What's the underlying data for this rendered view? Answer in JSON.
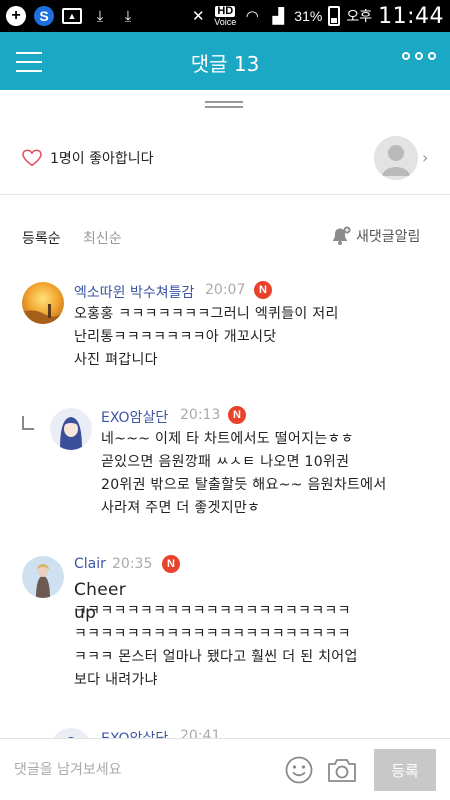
{
  "status_bar": {
    "battery_percent": "31%",
    "ampm": "오후",
    "time": "11:44",
    "hd_label": "HD",
    "voice_label": "Voice"
  },
  "header": {
    "title": "댓글 13"
  },
  "likes": {
    "text": "1명이 좋아합니다"
  },
  "sort": {
    "tabs": [
      "등록순",
      "최신순"
    ],
    "active": "등록순",
    "notify_label": "새댓글알림"
  },
  "comments": [
    {
      "name": "엑소따윈 박수쳐틀감",
      "time": "20:07",
      "badge": "N",
      "text": "오홍홍 ㅋㅋㅋㅋㅋㅋㅋ그러니 엑퀴들이 저리\n난리통ㅋㅋㅋㅋㅋㅋㅋ아 개꼬시닷\n사진 펴갑니다",
      "avatar_icon": "sunset-avatar"
    },
    {
      "name": "EXO암살단",
      "time": "20:13",
      "badge": "N",
      "text": "네~~~ 이제 타 차트에서도 떨어지는ㅎㅎ\n곧있으면 음원깡패 ㅆㅅㅌ 나오면 10위권\n20위권 밖으로 탈출할듯 해요~~ 음원차트에서\n사라져 주면 더 좋겟지만ㅎ",
      "avatar_icon": "girl-avatar",
      "is_reply": true
    },
    {
      "name": "Clair",
      "time": "20:35",
      "badge": "N",
      "text_first": "Cheer up",
      "text": "ㅋㅋㅋㅋㅋㅋㅋㅋㅋㅋㅋㅋㅋㅋㅋㅋㅋㅋㅋㅋㅋ\nㅋㅋㅋㅋㅋㅋㅋㅋㅋㅋㅋㅋㅋㅋㅋㅋㅋㅋㅋㅋㅋ\nㅋㅋㅋ 몬스터 얼마나 됐다고 훨씬 더 된 치어업\n보다 내려가냐",
      "avatar_icon": "person-avatar"
    },
    {
      "name": "EXO암살단",
      "time": "20:41",
      "avatar_icon": "girl-avatar",
      "is_reply": true
    }
  ],
  "composer": {
    "placeholder": "댓글을 남겨보세요",
    "submit_label": "등록"
  },
  "colors": {
    "header": "#1aa8c5",
    "name_link": "#3d56a3",
    "badge": "#e8432a",
    "submit_disabled": "#c8c8c8"
  }
}
